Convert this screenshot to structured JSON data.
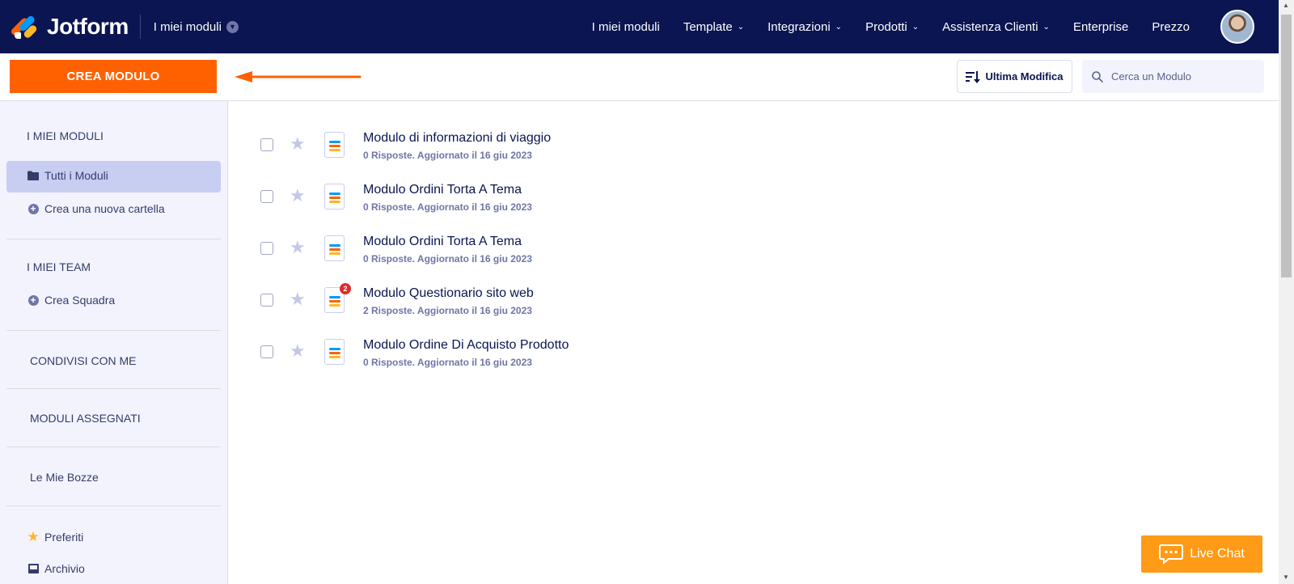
{
  "header": {
    "brand": "Jotform",
    "workspace": "I miei moduli",
    "nav": [
      {
        "label": "I miei moduli",
        "dropdown": false
      },
      {
        "label": "Template",
        "dropdown": true
      },
      {
        "label": "Integrazioni",
        "dropdown": true
      },
      {
        "label": "Prodotti",
        "dropdown": true
      },
      {
        "label": "Assistenza Clienti",
        "dropdown": true
      },
      {
        "label": "Enterprise",
        "dropdown": false
      },
      {
        "label": "Prezzo",
        "dropdown": false
      }
    ]
  },
  "toolbar": {
    "create_label": "CREA MODULO",
    "sort_label": "Ultima Modifica",
    "search_placeholder": "Cerca un Modulo"
  },
  "sidebar": {
    "section_my_forms": "I MIEI MODULI",
    "all_forms": "Tutti i Moduli",
    "new_folder": "Crea una nuova cartella",
    "section_teams": "I MIEI TEAM",
    "create_team": "Crea Squadra",
    "shared": "CONDIVISI CON ME",
    "assigned": "MODULI ASSEGNATI",
    "drafts": "Le Mie Bozze",
    "favorites": "Preferiti",
    "archive": "Archivio"
  },
  "forms": [
    {
      "title": "Modulo di informazioni di viaggio",
      "meta": "0 Risposte. Aggiornato il 16 giu 2023",
      "badge": ""
    },
    {
      "title": "Modulo Ordini Torta A Tema",
      "meta": "0 Risposte. Aggiornato il 16 giu 2023",
      "badge": ""
    },
    {
      "title": "Modulo Ordini Torta A Tema",
      "meta": "0 Risposte. Aggiornato il 16 giu 2023",
      "badge": ""
    },
    {
      "title": "Modulo Questionario sito web",
      "meta": "2 Risposte. Aggiornato il 16 giu 2023",
      "badge": "2"
    },
    {
      "title": "Modulo Ordine Di Acquisto Prodotto",
      "meta": "0 Risposte. Aggiornato il 16 giu 2023",
      "badge": ""
    }
  ],
  "live_chat": "Live Chat",
  "colors": {
    "navy": "#0a1551",
    "orange": "#ff6100",
    "chat_orange": "#ff9b17",
    "sidebar_bg": "#f3f3fe",
    "active_bg": "#c8cdf2"
  }
}
